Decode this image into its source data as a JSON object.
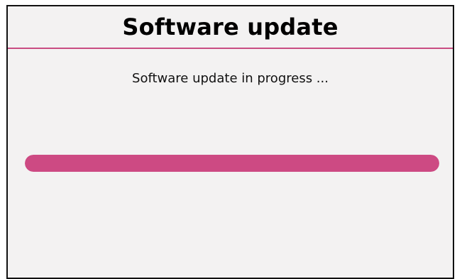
{
  "dialog": {
    "title": "Software update",
    "status_text": "Software update in progress ...",
    "progress": 1.0
  },
  "colors": {
    "accent": "#cd4a83",
    "divider": "#c94d82",
    "background": "#f3f2f2",
    "border": "#111111"
  }
}
